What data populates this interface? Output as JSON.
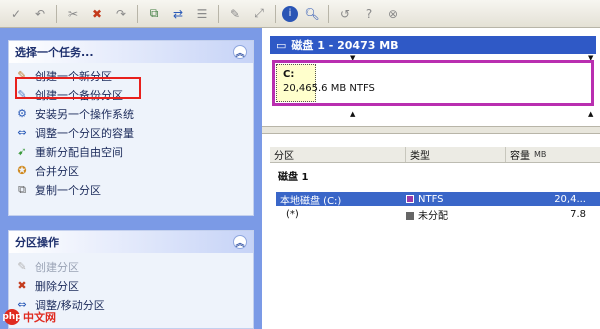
{
  "toolbar": {
    "icons": [
      "apply-icon",
      "undo-icon",
      "cut-icon",
      "delete-icon",
      "redo-icon",
      "copy-icon",
      "move-icon",
      "properties-icon",
      "wizard-icon",
      "resize-icon",
      "info-icon",
      "search-icon",
      "back-icon",
      "help-icon",
      "stop-icon"
    ]
  },
  "tasks": {
    "title": "选择一个任务...",
    "items": [
      {
        "label": "创建一个新分区"
      },
      {
        "label": "创建一个备份分区"
      },
      {
        "label": "安装另一个操作系统"
      },
      {
        "label": "调整一个分区的容量"
      },
      {
        "label": "重新分配自由空间"
      },
      {
        "label": "合并分区"
      },
      {
        "label": "复制一个分区"
      }
    ]
  },
  "ops": {
    "title": "分区操作",
    "items": [
      {
        "label": "创建分区"
      },
      {
        "label": "删除分区"
      },
      {
        "label": "调整/移动分区"
      }
    ]
  },
  "disk": {
    "title": "磁盘 1 - 20473 MB",
    "partition_label": "C:",
    "partition_info": "20,465.6 MB   NTFS"
  },
  "table": {
    "headers": [
      "分区",
      "类型",
      "容量"
    ],
    "capacity_unit": "MB",
    "group": "磁盘 1",
    "rows": [
      {
        "name": "本地磁盘 (C:)",
        "type": "NTFS",
        "capacity": "20,4...",
        "color": "#9b3aa8",
        "selected": true
      },
      {
        "name": "(*)",
        "type": "未分配",
        "capacity": "7.8",
        "color": "#666666",
        "selected": false
      }
    ]
  },
  "watermark": {
    "logo": "php",
    "text": "中文网"
  },
  "colors": {
    "highlight": "#e8201c",
    "partition_border": "#b92fb0",
    "disk_title": "#2f59c6",
    "selection": "#3a66c8"
  }
}
